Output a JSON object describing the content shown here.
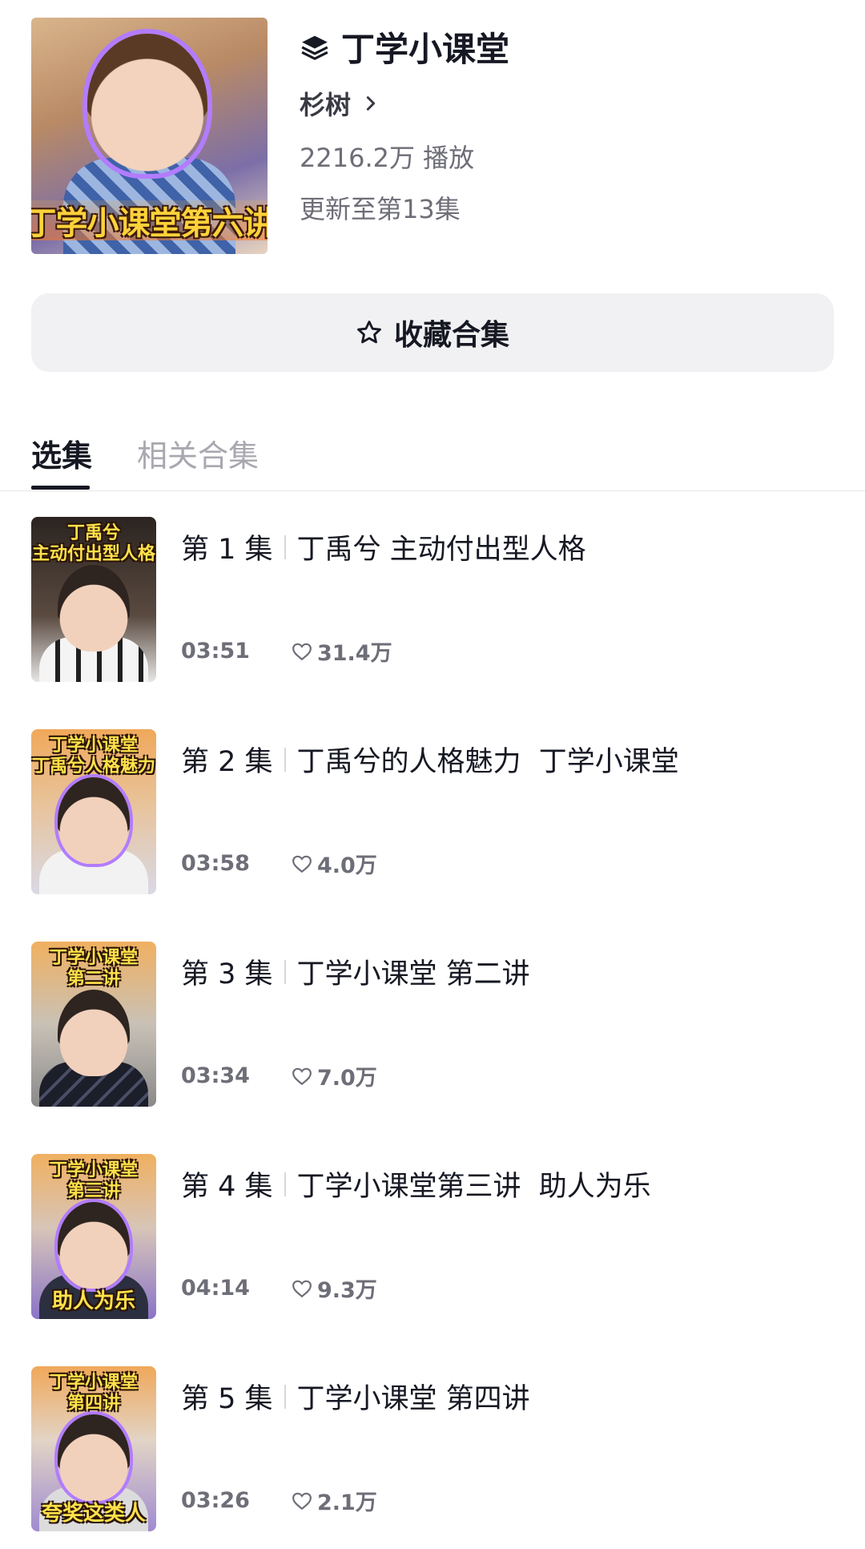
{
  "collection": {
    "cover_banner": "丁学小课堂第六讲",
    "title": "丁学小课堂",
    "author": "杉树",
    "plays": "2216.2万 播放",
    "updated": "更新至第13集",
    "collect_label": "收藏合集"
  },
  "tabs": [
    {
      "label": "选集",
      "active": true
    },
    {
      "label": "相关合集",
      "active": false
    }
  ],
  "episodes": [
    {
      "number": "第 1 集",
      "title": "丁禹兮 主动付出型人格",
      "duration": "03:51",
      "likes": "31.4万",
      "thumb_caption": "丁禹兮\n主动付出型人格",
      "thumb_bottom": ""
    },
    {
      "number": "第 2 集",
      "title": "丁禹兮的人格魅力  丁学小课堂",
      "duration": "03:58",
      "likes": "4.0万",
      "thumb_caption": "丁学小课堂\n丁禹兮人格魅力",
      "thumb_bottom": ""
    },
    {
      "number": "第 3 集",
      "title": "丁学小课堂 第二讲",
      "duration": "03:34",
      "likes": "7.0万",
      "thumb_caption": "丁学小课堂\n第二讲",
      "thumb_bottom": ""
    },
    {
      "number": "第 4 集",
      "title": "丁学小课堂第三讲  助人为乐",
      "duration": "04:14",
      "likes": "9.3万",
      "thumb_caption": "丁学小课堂\n第三讲",
      "thumb_bottom": "助人为乐"
    },
    {
      "number": "第 5 集",
      "title": "丁学小课堂 第四讲",
      "duration": "03:26",
      "likes": "2.1万",
      "thumb_caption": "丁学小课堂\n第四讲",
      "thumb_bottom": "夸奖这类人"
    }
  ],
  "colors": {
    "text_primary": "#161823",
    "text_secondary": "#6e6e78",
    "tab_inactive": "#a8a8b0",
    "button_bg": "#f1f1f3",
    "thumb_caption": "#ffe14a"
  },
  "icons": {
    "title": "layers-icon",
    "author_arrow": "chevron-right-icon",
    "collect": "star-outline-icon",
    "likes": "heart-outline-icon"
  }
}
